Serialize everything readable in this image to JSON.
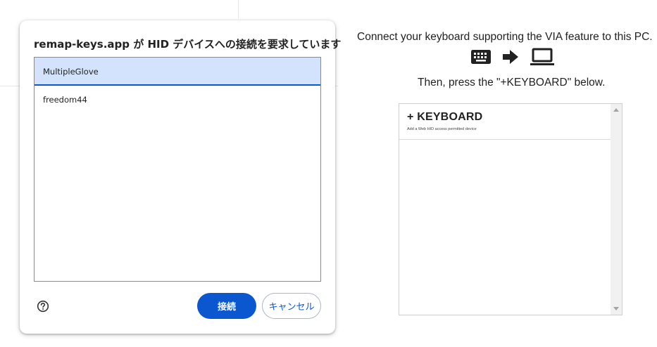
{
  "dialog": {
    "title": "remap-keys.app が HID デバイスへの接続を要求しています",
    "devices": [
      {
        "label": "MultipleGlove",
        "selected": true
      },
      {
        "label": "freedom44",
        "selected": false
      }
    ],
    "help_icon": "help-circle-icon",
    "connect_label": "接続",
    "cancel_label": "キャンセル"
  },
  "main": {
    "connect_text": "Connect your keyboard supporting the VIA feature to this PC.",
    "icons": [
      "keyboard-icon",
      "arrow-right-icon",
      "laptop-icon"
    ],
    "then_text": "Then, press the \"+KEYBOARD\" below.",
    "keyboard_item": {
      "title": "+ KEYBOARD",
      "subtitle": "Add a Web HID access permitted device"
    }
  },
  "colors": {
    "accent": "#0b57d0",
    "selected_bg": "#d3e3fd"
  }
}
